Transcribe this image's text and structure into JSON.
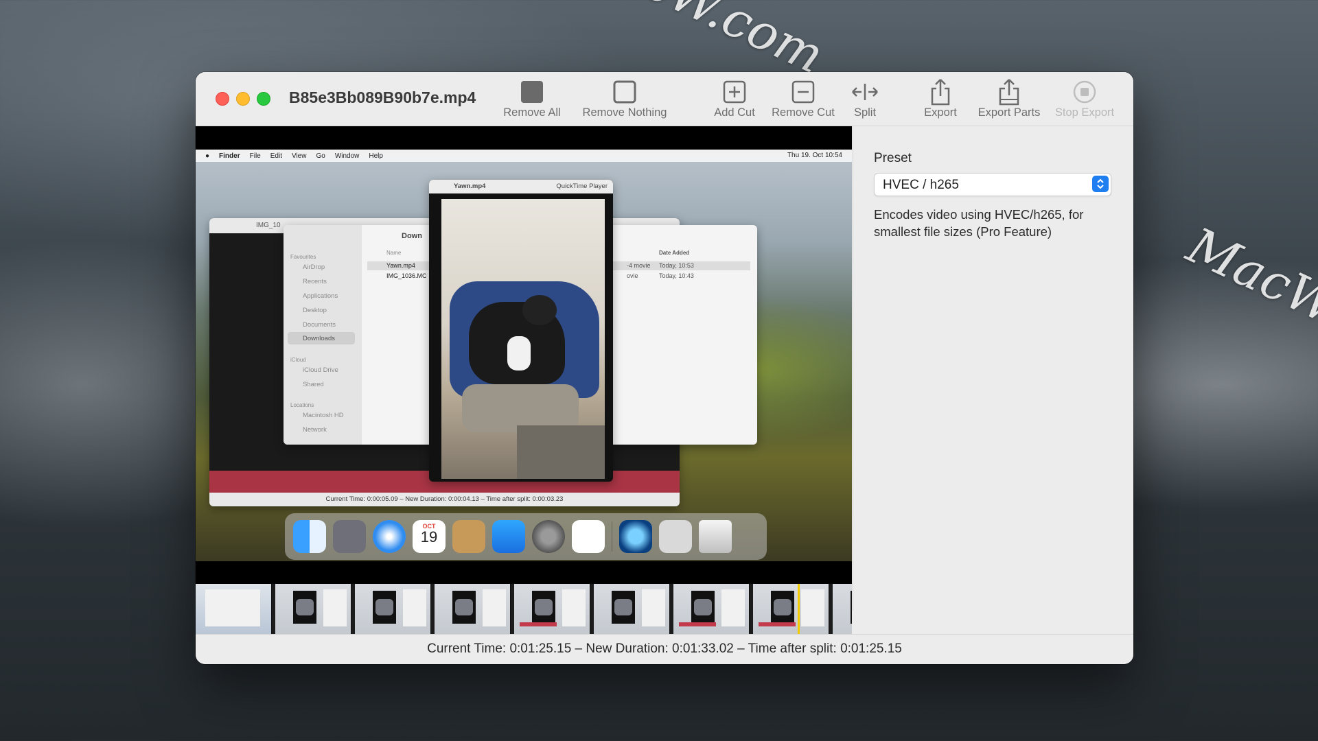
{
  "watermarks": [
    "MacW.com",
    "MacW.co"
  ],
  "window": {
    "title": "B85e3Bb089B90b7e.mp4"
  },
  "toolbar": {
    "remove_all": "Remove All",
    "remove_nothing": "Remove Nothing",
    "add_cut": "Add Cut",
    "remove_cut": "Remove Cut",
    "split": "Split",
    "export": "Export",
    "export_parts": "Export Parts",
    "stop_export": "Stop Export"
  },
  "video_preview": {
    "menubar": {
      "app": "Finder",
      "items": [
        "File",
        "Edit",
        "View",
        "Go",
        "Window",
        "Help"
      ],
      "clock": "Thu 19. Oct  10:54"
    },
    "quicktime": {
      "title": "Yawn.mp4",
      "app_label": "QuickTime Player"
    },
    "finder": {
      "path": "Down",
      "sidebar_favourites": "Favourites",
      "sidebar_items": [
        "AirDrop",
        "Recents",
        "Applications",
        "Desktop",
        "Documents",
        "Downloads"
      ],
      "sidebar_icloud": "iCloud",
      "icloud_items": [
        "iCloud Drive",
        "Shared"
      ],
      "sidebar_locations": "Locations",
      "location_items": [
        "Macintosh HD",
        "Network"
      ],
      "col_name": "Name",
      "col_date": "Date Added",
      "files": [
        {
          "name": "Yawn.mp4",
          "kind": "-4 movie",
          "date": "Today, 10:53"
        },
        {
          "name": "IMG_1036.MC",
          "kind": "ovie",
          "date": "Today, 10:43"
        }
      ]
    },
    "back_window_title": "IMG_10",
    "inner_status": "Current Time: 0:00:05.09 – New Duration: 0:00:04.13 – Time after split: 0:00:03.23",
    "calendar_day": "19",
    "calendar_month": "OCT"
  },
  "filmstrip": {
    "frame_count": 9,
    "playhead_position_fraction": 0.92
  },
  "sidebar": {
    "preset_label": "Preset",
    "preset_value": "HVEC / h265",
    "preset_description": "Encodes video using HVEC/h265, for smallest file sizes (Pro Feature)"
  },
  "status": {
    "text": "Current Time: 0:01:25.15 – New Duration: 0:01:33.02 – Time after split: 0:01:25.15"
  },
  "colors": {
    "accent": "#1f7ef0",
    "playhead": "#f2cc00",
    "close": "#fe5f57",
    "minimize": "#febc2e",
    "zoom": "#28c840"
  }
}
